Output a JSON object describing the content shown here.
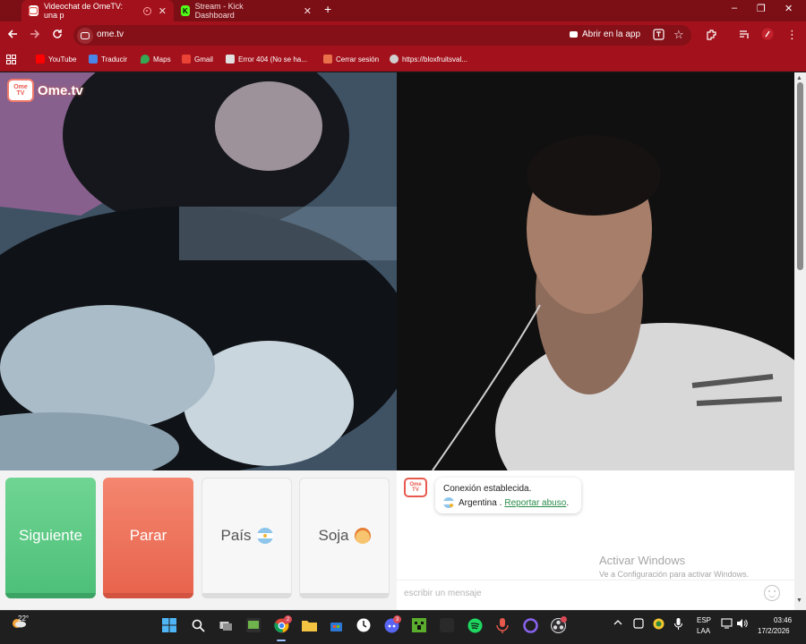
{
  "tabs": [
    {
      "title": "Videochat de OmeTV: una p",
      "favicon": "ometv-favicon",
      "recording": true,
      "active": true
    },
    {
      "title": "Stream - Kick Dashboard",
      "favicon": "kick-favicon",
      "favicon_letter": "K",
      "active": false
    }
  ],
  "window_controls": {
    "minimize": "–",
    "restore": "❐",
    "close": "✕"
  },
  "omnibox": {
    "url": "ome.tv",
    "open_in_app": "Abrir en la app"
  },
  "bookmarks": [
    {
      "label": "YouTube",
      "color": "#ff0000"
    },
    {
      "label": "Traducir",
      "color": "#4a86e8"
    },
    {
      "label": "Maps",
      "color": "#34a853"
    },
    {
      "label": "Gmail",
      "color": "#ea4335"
    },
    {
      "label": "Error 404 (No se ha...",
      "color": "#e0e0e0"
    },
    {
      "label": "Cerrar sesión",
      "color": "#e8704a"
    },
    {
      "label": "https://bloxfruitsval...",
      "color": "#cfcfcf"
    }
  ],
  "logo": {
    "badge_line1": "Ome",
    "badge_line2": "TV",
    "wordmark": "Ome.tv"
  },
  "controls": {
    "next": "Siguiente",
    "stop": "Parar",
    "country": "País",
    "gender": "Soja"
  },
  "chat": {
    "status": "Conexión establecida.",
    "country": "Argentina .",
    "report_link": "Reportar abuso",
    "after_link": ".",
    "placeholder": "escribir un mensaje"
  },
  "watermark": {
    "title": "Activar Windows",
    "subtitle": "Ve a Configuración para activar Windows."
  },
  "taskbar": {
    "temperature": "22°",
    "discord_badge": "3",
    "chrome_badge": "2",
    "lang_line1": "ESP",
    "lang_line2": "LAA",
    "time": "03:46",
    "date": "17/2/2026"
  },
  "colors": {
    "browser_red": "#a3121c",
    "next_green": "#4ec07a",
    "stop_coral": "#e8644d",
    "link_green": "#2a8c4a"
  }
}
